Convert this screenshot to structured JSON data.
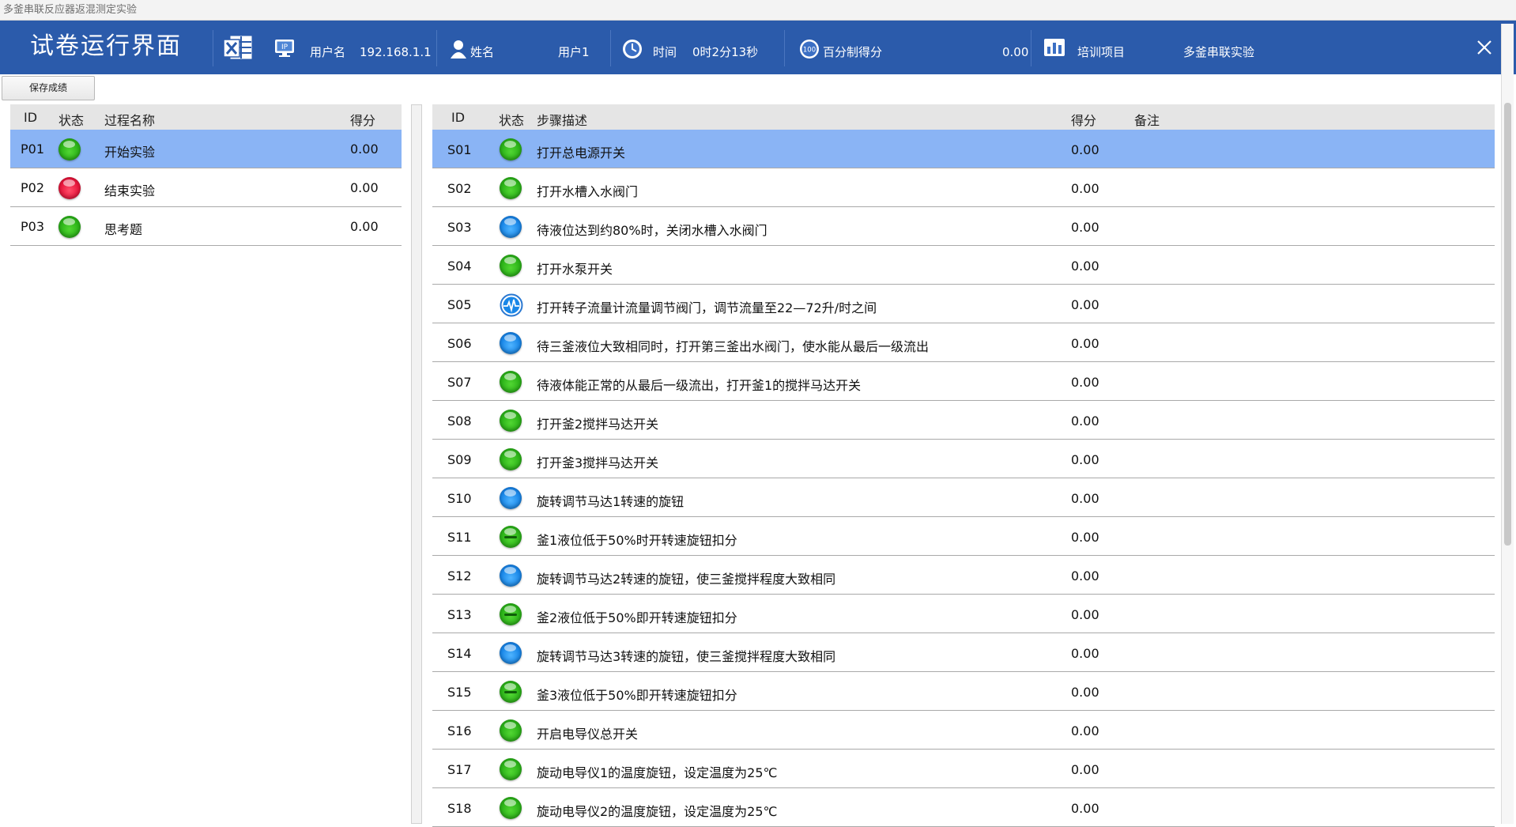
{
  "window": {
    "title": "多釜串联反应器返混测定实验"
  },
  "header": {
    "title": "试卷运行界面",
    "username_label": "用户名",
    "username_value": "192.168.1.1",
    "name_label": "姓名",
    "name_value": "用户1",
    "time_label": "时间",
    "time_value": "0时2分13秒",
    "score_label": "百分制得分",
    "score_value": "0.00",
    "project_label": "培训项目",
    "project_value": "多釜串联实验",
    "icons": [
      "excel-export-icon",
      "ip-icon",
      "user-icon",
      "clock-icon",
      "score-100-icon",
      "chart-icon",
      "close-icon"
    ]
  },
  "toolbar": {
    "save_label": "保存成绩"
  },
  "left_table": {
    "headers": {
      "id": "ID",
      "status": "状态",
      "name": "过程名称",
      "score": "得分"
    },
    "rows": [
      {
        "id": "P01",
        "status": "green",
        "name": "开始实验",
        "score": "0.00",
        "selected": true
      },
      {
        "id": "P02",
        "status": "red",
        "name": "结束实验",
        "score": "0.00",
        "selected": false
      },
      {
        "id": "P03",
        "status": "green",
        "name": "思考题",
        "score": "0.00",
        "selected": false
      }
    ]
  },
  "right_table": {
    "headers": {
      "id": "ID",
      "status": "状态",
      "desc": "步骤描述",
      "score": "得分",
      "note": "备注"
    },
    "rows": [
      {
        "id": "S01",
        "status": "green",
        "desc": "打开总电源开关",
        "score": "0.00",
        "selected": true
      },
      {
        "id": "S02",
        "status": "green",
        "desc": "打开水槽入水阀门",
        "score": "0.00"
      },
      {
        "id": "S03",
        "status": "blue",
        "desc": "待液位达到约80%时，关闭水槽入水阀门",
        "score": "0.00"
      },
      {
        "id": "S04",
        "status": "green",
        "desc": "打开水泵开关",
        "score": "0.00"
      },
      {
        "id": "S05",
        "status": "pulse",
        "desc": "打开转子流量计流量调节阀门，调节流量至22—72升/时之间",
        "score": "0.00"
      },
      {
        "id": "S06",
        "status": "blue",
        "desc": "待三釜液位大致相同时，打开第三釜出水阀门，使水能从最后一级流出",
        "score": "0.00"
      },
      {
        "id": "S07",
        "status": "green",
        "desc": "待液体能正常的从最后一级流出，打开釜1的搅拌马达开关",
        "score": "0.00"
      },
      {
        "id": "S08",
        "status": "green",
        "desc": "打开釜2搅拌马达开关",
        "score": "0.00"
      },
      {
        "id": "S09",
        "status": "green",
        "desc": "打开釜3搅拌马达开关",
        "score": "0.00"
      },
      {
        "id": "S10",
        "status": "blue",
        "desc": "旋转调节马达1转速的旋钮",
        "score": "0.00"
      },
      {
        "id": "S11",
        "status": "green-dash",
        "desc": "釜1液位低于50%时开转速旋钮扣分",
        "score": "0.00"
      },
      {
        "id": "S12",
        "status": "blue",
        "desc": "旋转调节马达2转速的旋钮，使三釜搅拌程度大致相同",
        "score": "0.00"
      },
      {
        "id": "S13",
        "status": "green-dash",
        "desc": "釜2液位低于50%即开转速旋钮扣分",
        "score": "0.00"
      },
      {
        "id": "S14",
        "status": "blue",
        "desc": "旋转调节马达3转速的旋钮，使三釜搅拌程度大致相同",
        "score": "0.00"
      },
      {
        "id": "S15",
        "status": "green-dash",
        "desc": "釜3液位低于50%即开转速旋钮扣分",
        "score": "0.00"
      },
      {
        "id": "S16",
        "status": "green",
        "desc": "开启电导仪总开关",
        "score": "0.00"
      },
      {
        "id": "S17",
        "status": "green",
        "desc": "旋动电导仪1的温度旋钮，设定温度为25℃",
        "score": "0.00"
      },
      {
        "id": "S18",
        "status": "green",
        "desc": "旋动电导仪2的温度旋钮，设定温度为25℃",
        "score": "0.00"
      }
    ]
  },
  "colors": {
    "header_bg": "#2b5bab",
    "selected_row": "#8ab4f5",
    "table_header_bg": "#e5e5e5",
    "status_green": "#2bb318",
    "status_red": "#e8163c",
    "status_blue": "#1987e8"
  }
}
